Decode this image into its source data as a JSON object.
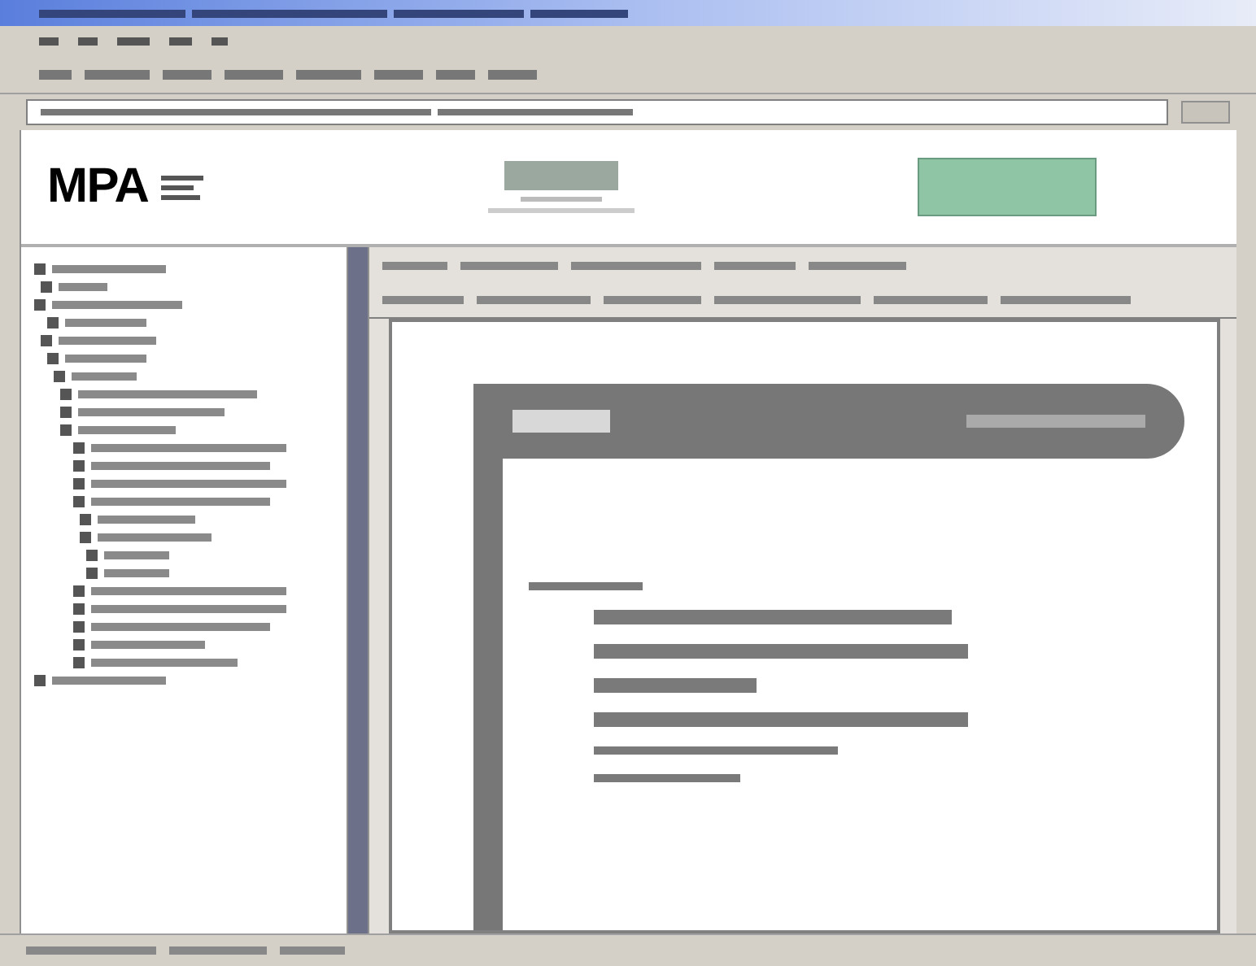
{
  "header": {
    "logo": "MPA"
  }
}
